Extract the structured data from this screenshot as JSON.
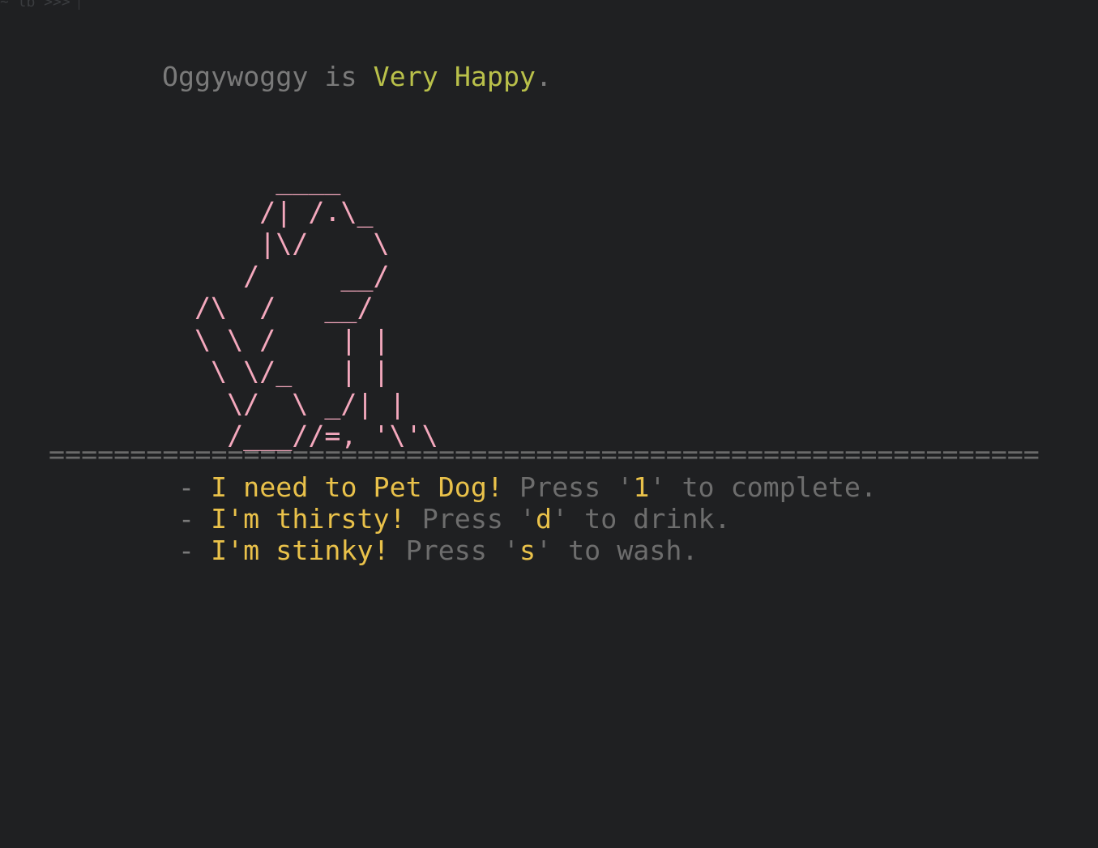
{
  "prompt": {
    "text": "~ lb >>>"
  },
  "status": {
    "pet_name": "Oggywoggy",
    "connector": " is ",
    "mood": "Very Happy",
    "end": "."
  },
  "art": {
    "lines": [
      "     ____",
      "    /| /.\\_",
      "    |\\/    \\",
      "   /     __/",
      "/\\  /   __/",
      "\\ \\ /    | |",
      " \\ \\/_   | |",
      "  \\/  \\ _/| |",
      "  /___//=, '\\'\\"
    ]
  },
  "divider": "=============================================================",
  "tasks": [
    {
      "bullet": "- ",
      "need": "I need to Pet Dog!",
      "press": " Press '",
      "key": "1",
      "rest": "' to complete."
    },
    {
      "bullet": "- ",
      "need": "I'm thirsty!",
      "press": " Press '",
      "key": "d",
      "rest": "' to drink."
    },
    {
      "bullet": "- ",
      "need": "I'm stinky!",
      "press": " Press '",
      "key": "s",
      "rest": "' to wash."
    }
  ],
  "colors": {
    "background": "#1f2022",
    "mood": "#b9c04a",
    "art": "#f4a8bd",
    "need": "#e9c14a",
    "dim": "#6d6d6d"
  }
}
